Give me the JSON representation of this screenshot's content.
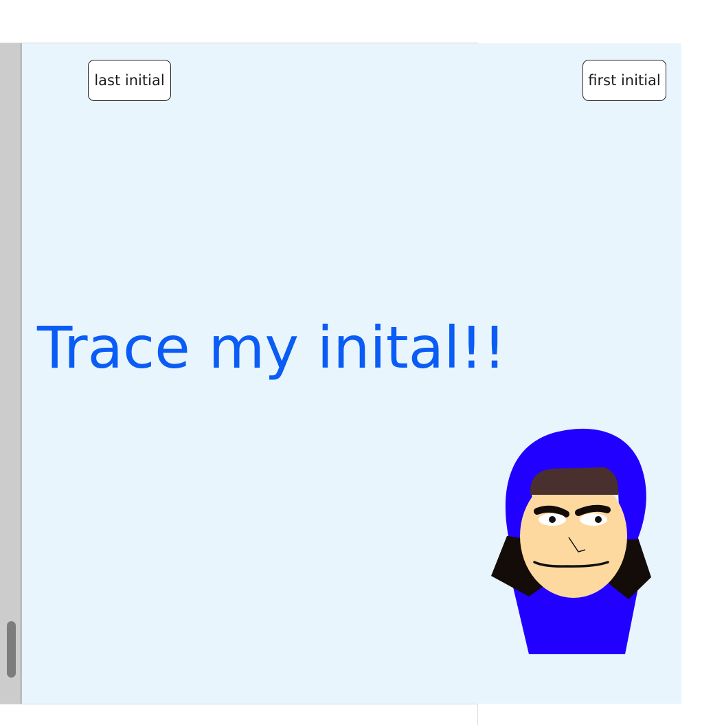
{
  "buttons": {
    "last_initial": "last initial",
    "first_initial": "first initial"
  },
  "heading": {
    "text": "Trace my inital!!"
  },
  "colors": {
    "canvas_background": "#e8f5fd",
    "heading": "#0a5cf4",
    "hood": "#2200ff",
    "hair": "#4a2f2f",
    "skin": "#fdd9a0",
    "dark_hair": "#140c08"
  },
  "character": {
    "icon": "hooded-character-icon"
  }
}
